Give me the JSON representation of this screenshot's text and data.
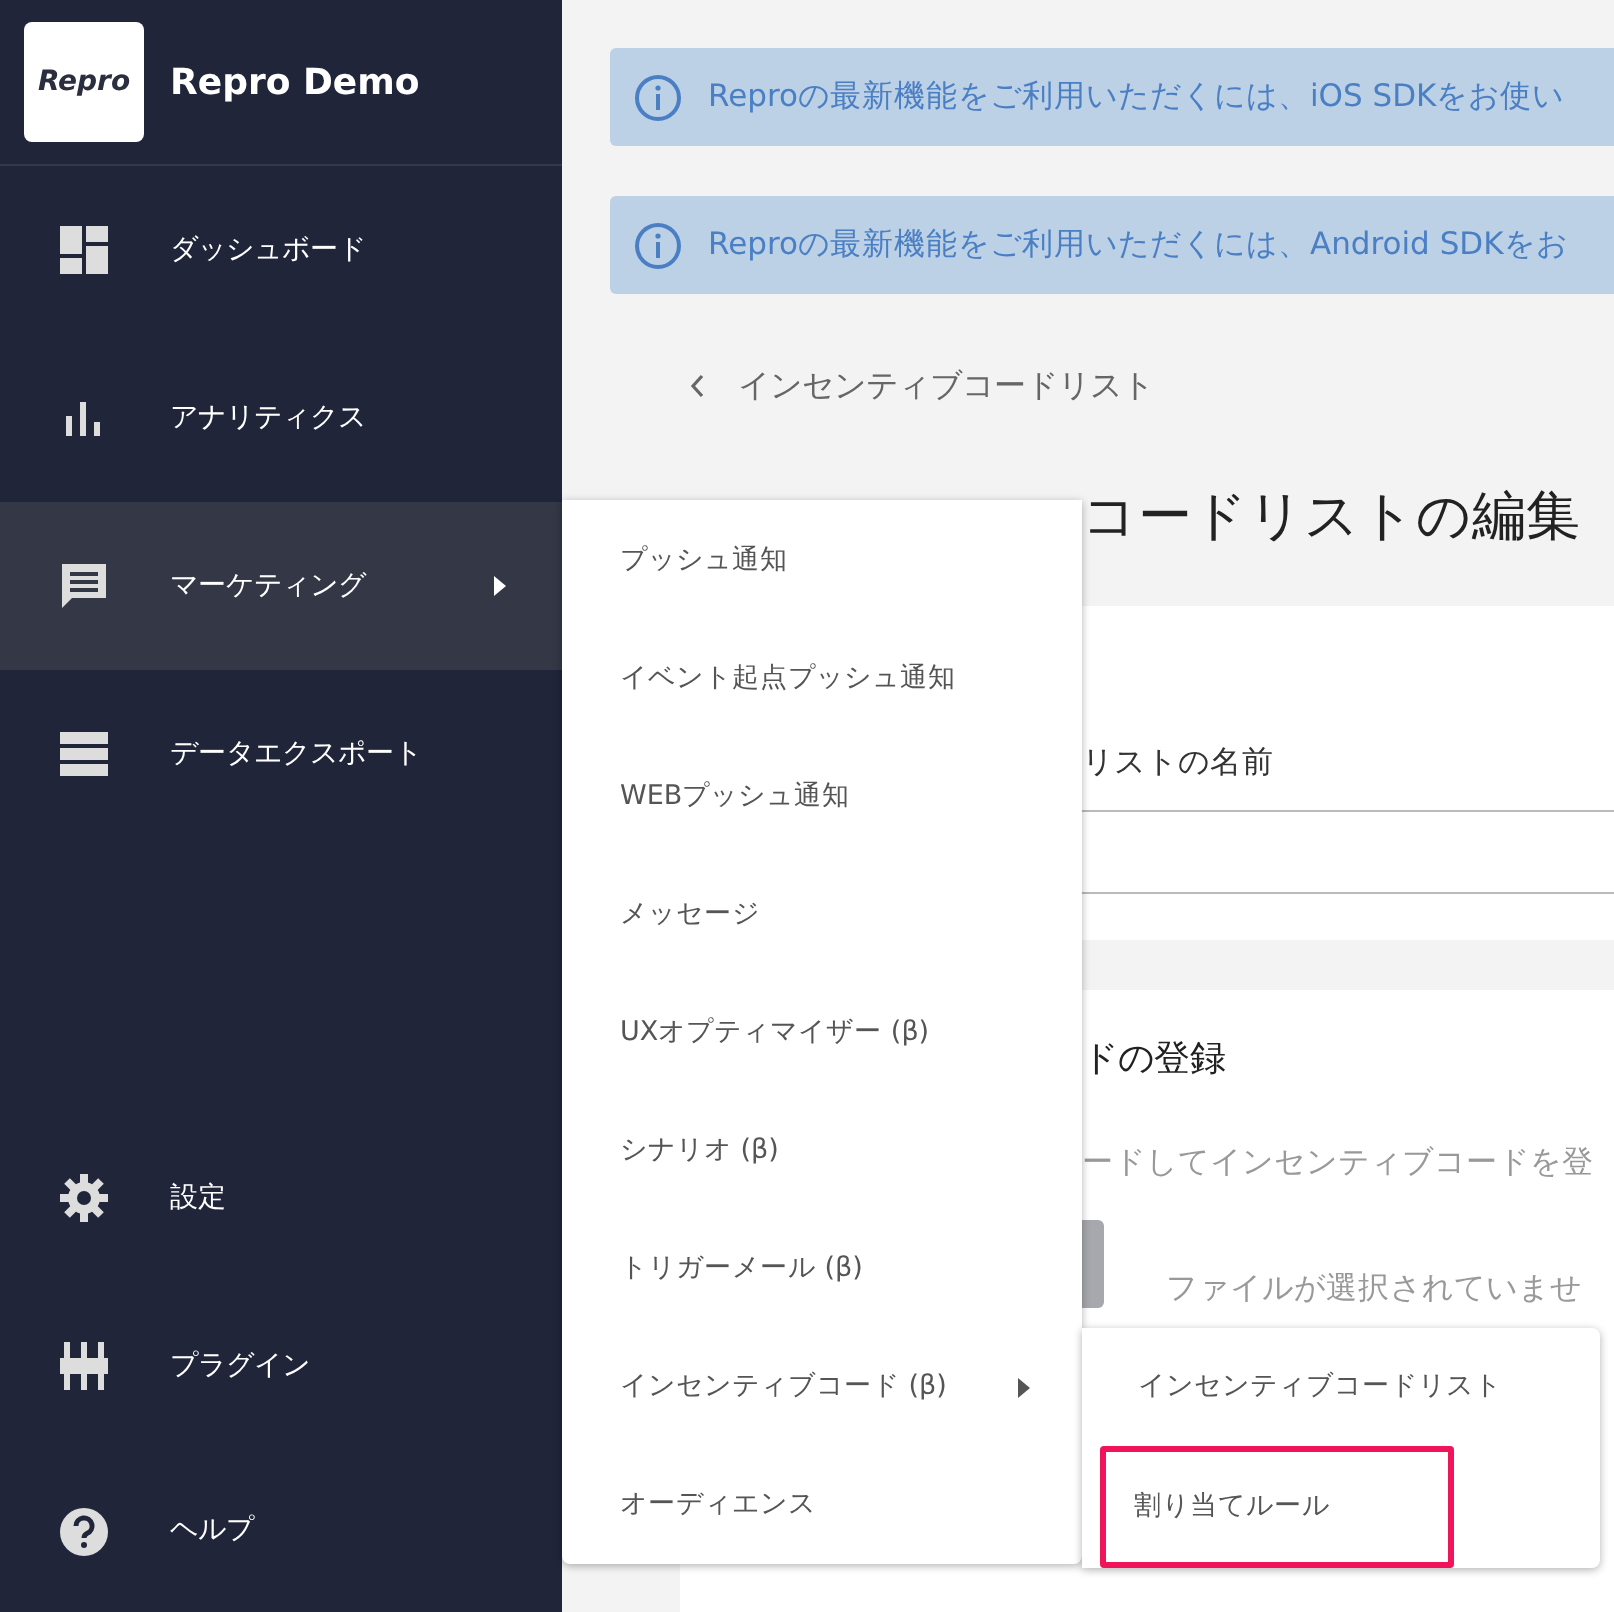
{
  "sidebar": {
    "logo": "Repro",
    "app_name": "Repro Demo",
    "items": [
      {
        "label": "ダッシュボード",
        "kind": "dashboard",
        "selected": false,
        "has_submenu": false
      },
      {
        "label": "アナリティクス",
        "kind": "analytics",
        "selected": false,
        "has_submenu": false
      },
      {
        "label": "マーケティング",
        "kind": "marketing",
        "selected": true,
        "has_submenu": true
      },
      {
        "label": "データエクスポート",
        "kind": "export",
        "selected": false,
        "has_submenu": false
      }
    ],
    "bottom_items": [
      {
        "label": "設定",
        "kind": "settings",
        "selected": false,
        "has_submenu": false
      },
      {
        "label": "プラグイン",
        "kind": "plugin",
        "selected": false,
        "has_submenu": false
      },
      {
        "label": "ヘルプ",
        "kind": "help",
        "selected": false,
        "has_submenu": false
      }
    ]
  },
  "banners": [
    {
      "text": "Reproの最新機能をご利用いただくには、iOS SDKをお使い"
    },
    {
      "text": "Reproの最新機能をご利用いただくには、Android SDKをお"
    }
  ],
  "breadcrumb": {
    "label": "インセンティブコードリスト"
  },
  "page_title": "コードリストの編集",
  "name_card": {
    "label": "リストの名前"
  },
  "upload_card": {
    "heading": "ドの登録",
    "description": "ードしてインセンティブコードを登",
    "file_status": "ファイルが選択されていませ"
  },
  "menu": {
    "items": [
      {
        "label": "プッシュ通知",
        "has_submenu": false
      },
      {
        "label": "イベント起点プッシュ通知",
        "has_submenu": false
      },
      {
        "label": "WEBプッシュ通知",
        "has_submenu": false
      },
      {
        "label": "メッセージ",
        "has_submenu": false
      },
      {
        "label": "UXオプティマイザー (β)",
        "has_submenu": false
      },
      {
        "label": "シナリオ (β)",
        "has_submenu": false
      },
      {
        "label": "トリガーメール (β)",
        "has_submenu": false
      },
      {
        "label": "インセンティブコード (β)",
        "has_submenu": true
      },
      {
        "label": "オーディエンス",
        "has_submenu": false
      }
    ]
  },
  "submenu": {
    "items": [
      {
        "label": "インセンティブコードリスト",
        "highlighted": false
      },
      {
        "label": "割り当てルール",
        "highlighted": true
      }
    ]
  }
}
